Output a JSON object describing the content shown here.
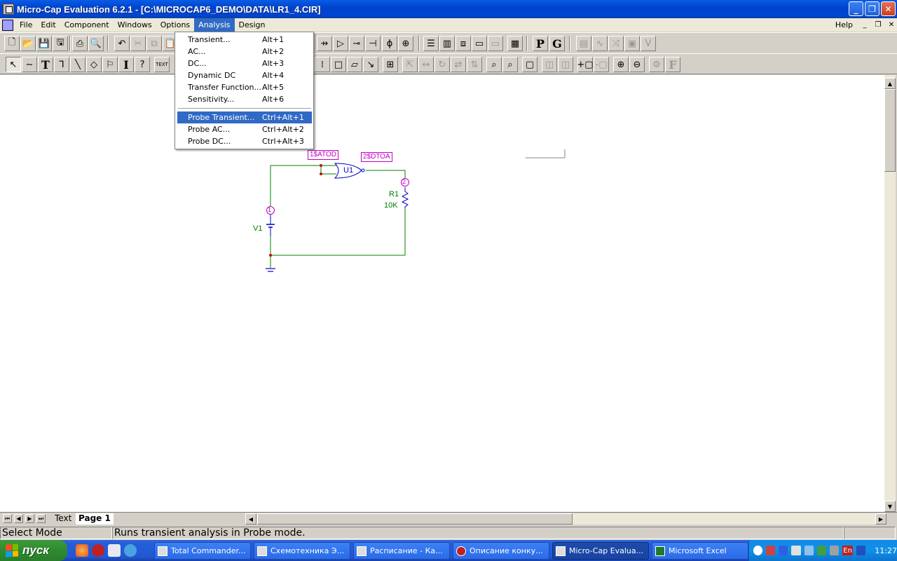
{
  "window": {
    "title": "Micro-Cap Evaluation 6.2.1 - [C:\\MICROCAP6_DEMO\\DATA\\LR1_4.CIR]"
  },
  "menubar": {
    "items": [
      "File",
      "Edit",
      "Component",
      "Windows",
      "Options",
      "Analysis",
      "Design"
    ],
    "help": "Help"
  },
  "analysis_menu": {
    "items": [
      {
        "label": "Transient...",
        "shortcut": "Alt+1"
      },
      {
        "label": "AC...",
        "shortcut": "Alt+2"
      },
      {
        "label": "DC...",
        "shortcut": "Alt+3"
      },
      {
        "label": "Dynamic DC",
        "shortcut": "Alt+4"
      },
      {
        "label": "Transfer Function...",
        "shortcut": "Alt+5"
      },
      {
        "label": "Sensitivity...",
        "shortcut": "Alt+6"
      },
      {
        "label": "Probe Transient...",
        "shortcut": "Ctrl+Alt+1"
      },
      {
        "label": "Probe AC...",
        "shortcut": "Ctrl+Alt+2"
      },
      {
        "label": "Probe DC...",
        "shortcut": "Ctrl+Alt+3"
      }
    ]
  },
  "toolbar": {
    "p_label": "P",
    "g_label": "G",
    "text_label": "TEXT"
  },
  "schematic": {
    "v1": "V1",
    "r1": "R1",
    "r1_value": "10K",
    "u1": "U1",
    "node1": "1",
    "node2": "2",
    "pin_atod": "1$ATOD",
    "pin_dtoa": "2$DTOA",
    "colors": {
      "wire": "#008000",
      "component": "#0000c0",
      "pin": "#c000c0",
      "node_dot": "#cc0000"
    }
  },
  "tabs": {
    "text": "Text",
    "page": "Page 1"
  },
  "status": {
    "mode": "Select Mode",
    "hint": "Runs transient analysis in Probe mode."
  },
  "taskbar": {
    "start": "пуск",
    "tasks": [
      "Total Commander...",
      "Схемотехника Э...",
      "Расписание - Ка...",
      "Описание конку...",
      "Micro-Cap Evalua...",
      "Microsoft Excel"
    ],
    "lang": "En",
    "clock": "11:27"
  }
}
